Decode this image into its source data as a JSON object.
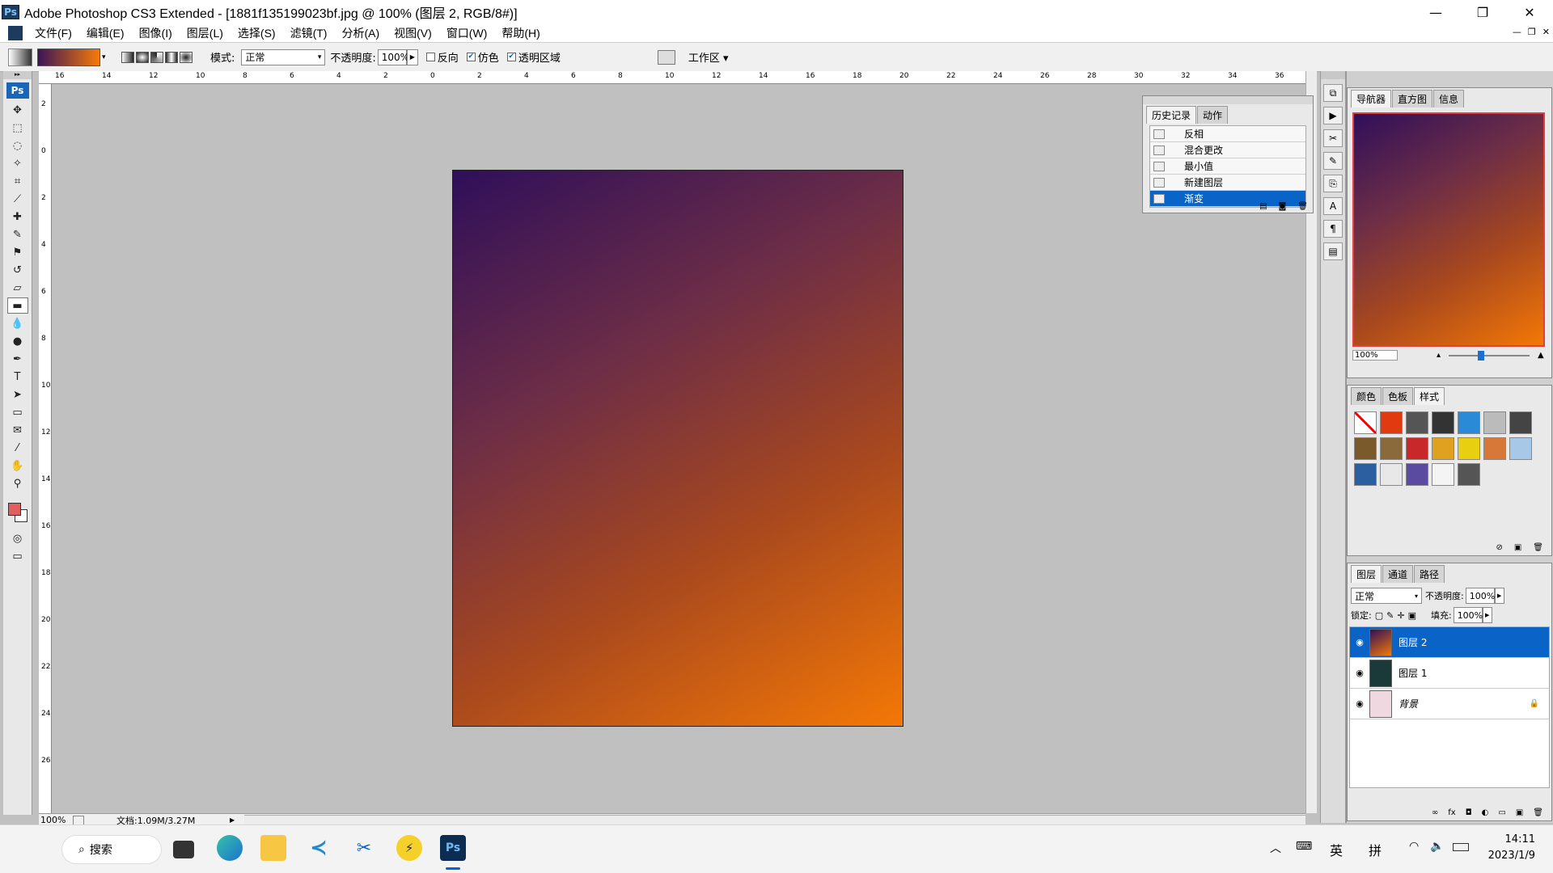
{
  "window": {
    "title": "Adobe Photoshop CS3 Extended - [1881f135199023bf.jpg @ 100% (图层 2, RGB/8#)]",
    "app_icon": "Ps",
    "controls": {
      "minimize": "—",
      "restore": "❐",
      "close": "✕"
    }
  },
  "menu": {
    "items": [
      "文件(F)",
      "编辑(E)",
      "图像(I)",
      "图层(L)",
      "选择(S)",
      "滤镜(T)",
      "分析(A)",
      "视图(V)",
      "窗口(W)",
      "帮助(H)"
    ]
  },
  "options": {
    "mode_label": "模式:",
    "mode_value": "正常",
    "opacity_label": "不透明度:",
    "opacity_value": "100%",
    "reverse_label": "反向",
    "dither_label": "仿色",
    "transparency_label": "透明区域",
    "reverse_checked": false,
    "dither_checked": true,
    "transparency_checked": true,
    "workspace_label": "工作区 ▾",
    "gradient_start": "#3a1458",
    "gradient_end": "#f67a08"
  },
  "rulers": {
    "top": [
      "16",
      "14",
      "12",
      "10",
      "8",
      "6",
      "4",
      "2",
      "0",
      "2",
      "4",
      "6",
      "8",
      "10",
      "12",
      "14",
      "16",
      "18",
      "20",
      "22",
      "24",
      "26",
      "28",
      "30",
      "32",
      "34",
      "36"
    ],
    "left": [
      "2",
      "0",
      "2",
      "4",
      "6",
      "8",
      "10",
      "12",
      "14",
      "16",
      "18",
      "20",
      "22",
      "24",
      "26"
    ]
  },
  "toolbox": {
    "ps_label": "Ps",
    "tools": [
      "move",
      "marquee",
      "lasso",
      "magic-wand",
      "crop",
      "slice",
      "healing",
      "brush",
      "stamp",
      "history-brush",
      "eraser",
      "gradient",
      "blur",
      "dodge",
      "pen",
      "type",
      "path-select",
      "shape",
      "notes",
      "eyedropper",
      "hand",
      "zoom"
    ],
    "foreground_color": "#e06060",
    "background_color": "#ffffff"
  },
  "history": {
    "tabs": [
      "历史记录",
      "动作"
    ],
    "items": [
      "反相",
      "混合更改",
      "最小值",
      "新建图层",
      "渐变"
    ],
    "selected": "渐变"
  },
  "navigator": {
    "tabs": [
      "导航器",
      "直方图",
      "信息"
    ],
    "zoom": "100%"
  },
  "styles": {
    "tabs": [
      "颜色",
      "色板",
      "样式"
    ]
  },
  "layers": {
    "tabs": [
      "图层",
      "通道",
      "路径"
    ],
    "blend_mode": "正常",
    "opacity_label": "不透明度:",
    "opacity_value": "100%",
    "lock_label": "锁定:",
    "fill_label": "填充:",
    "fill_value": "100%",
    "items": [
      {
        "name": "图层 2",
        "active": true
      },
      {
        "name": "图层 1",
        "active": false
      },
      {
        "name": "背景",
        "active": false,
        "locked": true
      }
    ]
  },
  "status": {
    "zoom": "100%",
    "doc_info": "文档:1.09M/3.27M"
  },
  "taskbar": {
    "search_label": "搜索",
    "clock_time": "14:11",
    "clock_date": "2023/1/9",
    "ime_lang": "英",
    "ime_mode": "拼"
  }
}
